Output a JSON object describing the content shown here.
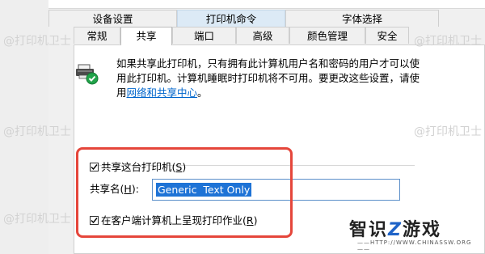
{
  "tabs_top": [
    {
      "label": "设备设置"
    },
    {
      "label": "打印机命令"
    },
    {
      "label": "字体选择"
    }
  ],
  "tabs_bottom": [
    {
      "label": "常规"
    },
    {
      "label": "共享"
    },
    {
      "label": "端口"
    },
    {
      "label": "高级"
    },
    {
      "label": "颜色管理"
    },
    {
      "label": "安全"
    }
  ],
  "sharing": {
    "description": "如果共享此打印机，只有拥有此计算机用户名和密码的用户才可以使用此打印机。计算机睡眠时打印机将不可用。要更改这些设置，请使用",
    "link_text": "网络和共享中心",
    "link_suffix": "。",
    "share_checkbox": {
      "label": "共享这台打印机",
      "accel_open": "(",
      "accel": "S",
      "accel_close": ")",
      "checked": true
    },
    "share_name": {
      "label": "共享名",
      "accel_open": "(",
      "accel": "H",
      "accel_close": "):",
      "value": "Generic  Text Only"
    },
    "render_checkbox": {
      "label": "在客户端计算机上呈现打印作业",
      "accel_open": "(",
      "accel": "R",
      "accel_close": ")",
      "checked": true
    }
  },
  "watermark": {
    "text": "@打印机卫士"
  },
  "brand": {
    "logo_text": "智识",
    "logo_z": "Z",
    "logo_text2": "游戏",
    "url": "——HTTP://WWW.CHINASSW.ORG——"
  },
  "colors": {
    "highlight": "#e5463b",
    "selection": "#1e73d6",
    "link": "#0066cc"
  }
}
